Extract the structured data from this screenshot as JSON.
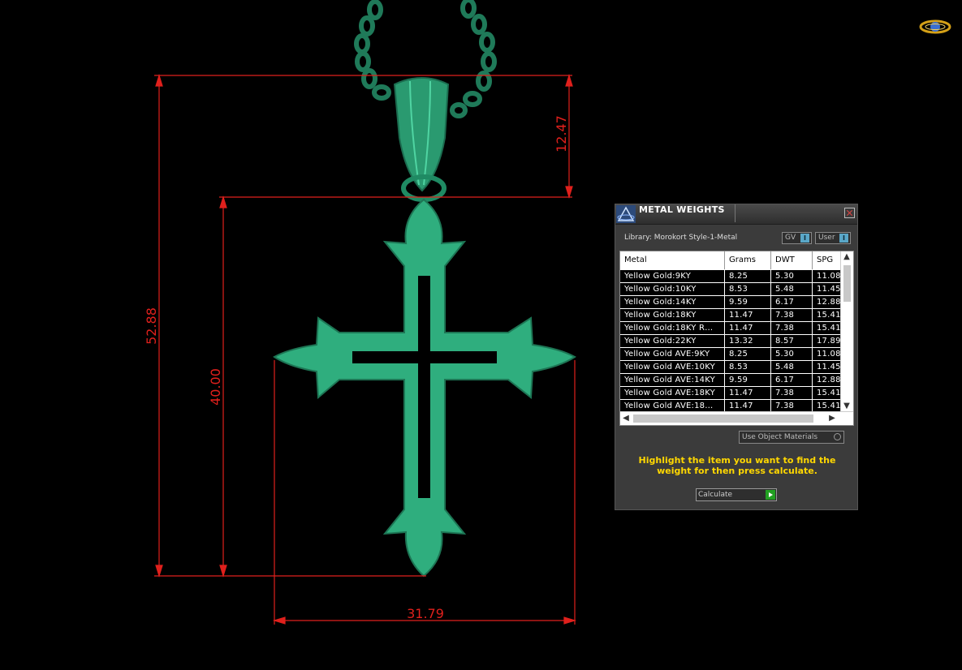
{
  "dimensions": {
    "total_height": "52.88",
    "cross_height": "40.00",
    "bail_height": "12.47",
    "cross_width": "31.79"
  },
  "panel": {
    "title": "METAL WEIGHTS",
    "library": "Library: Morokort Style-1-Metal",
    "toggle_gv": "GV",
    "toggle_user": "User",
    "columns": [
      "Metal",
      "Grams",
      "DWT",
      "SPG"
    ],
    "rows": [
      [
        "Yellow Gold:9KY",
        "8.25",
        "5.30",
        "11.08"
      ],
      [
        "Yellow Gold:10KY",
        "8.53",
        "5.48",
        "11.45"
      ],
      [
        "Yellow Gold:14KY",
        "9.59",
        "6.17",
        "12.88"
      ],
      [
        "Yellow Gold:18KY",
        "11.47",
        "7.38",
        "15.41"
      ],
      [
        "Yellow Gold:18KY R…",
        "11.47",
        "7.38",
        "15.41"
      ],
      [
        "Yellow Gold:22KY",
        "13.32",
        "8.57",
        "17.89"
      ],
      [
        "Yellow Gold AVE:9KY",
        "8.25",
        "5.30",
        "11.08"
      ],
      [
        "Yellow Gold AVE:10KY",
        "8.53",
        "5.48",
        "11.45"
      ],
      [
        "Yellow Gold AVE:14KY",
        "9.59",
        "6.17",
        "12.88"
      ],
      [
        "Yellow Gold AVE:18KY",
        "11.47",
        "7.38",
        "15.41"
      ],
      [
        "Yellow Gold AVE:18…",
        "11.47",
        "7.38",
        "15.41"
      ]
    ],
    "use_object_materials": "Use Object Materials",
    "hint": "Highlight the item you want to find the weight for then press calculate.",
    "calculate_label": "Calculate"
  },
  "colors": {
    "model": "#2fae7e",
    "dimension_lines": "#e0201c",
    "hint_text": "#ffd700"
  }
}
